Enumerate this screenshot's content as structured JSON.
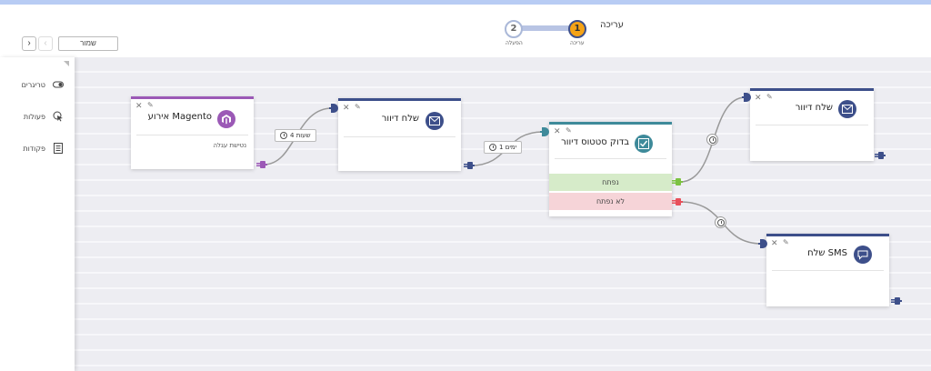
{
  "header": {
    "save_label": "שמור",
    "prev_label": "‹",
    "next_label": "›",
    "page_title": "עריכה",
    "steps": [
      {
        "number": "1",
        "label": "עריכה"
      },
      {
        "number": "2",
        "label": "הפעלה"
      }
    ]
  },
  "sidebar": {
    "items": [
      {
        "label": "טריגרים",
        "icon": "toggle-icon"
      },
      {
        "label": "פעולות",
        "icon": "cursor-click-icon"
      },
      {
        "label": "פקודות",
        "icon": "list-document-icon"
      }
    ]
  },
  "nodes": {
    "trigger": {
      "title": "אירוע Magento",
      "subtitle": "נטישת עגלה",
      "icon": "magento-icon",
      "accent": "#9b59b6"
    },
    "email1": {
      "title": "שלח דיוור",
      "icon": "envelope-icon",
      "accent": "#3d4f8a"
    },
    "check": {
      "title": "בדוק סטטוס דיוור",
      "icon": "check-square-icon",
      "accent": "#3e8a9a",
      "branch_yes": "נפתח",
      "branch_no": "לא נפתח"
    },
    "email2": {
      "title": "שלח דיוור",
      "icon": "envelope-icon",
      "accent": "#3d4f8a"
    },
    "sms": {
      "title": "שלח SMS",
      "icon": "chat-bubble-icon",
      "accent": "#3d4f8a"
    }
  },
  "delays": {
    "d1": "4 שעות",
    "d2": "1 ימים"
  },
  "colors": {
    "navy": "#3d4f8a",
    "purple": "#9b59b6",
    "teal": "#3e8a9a",
    "green": "#7cc242",
    "red": "#e8505b",
    "step_active": "#f5a316"
  }
}
